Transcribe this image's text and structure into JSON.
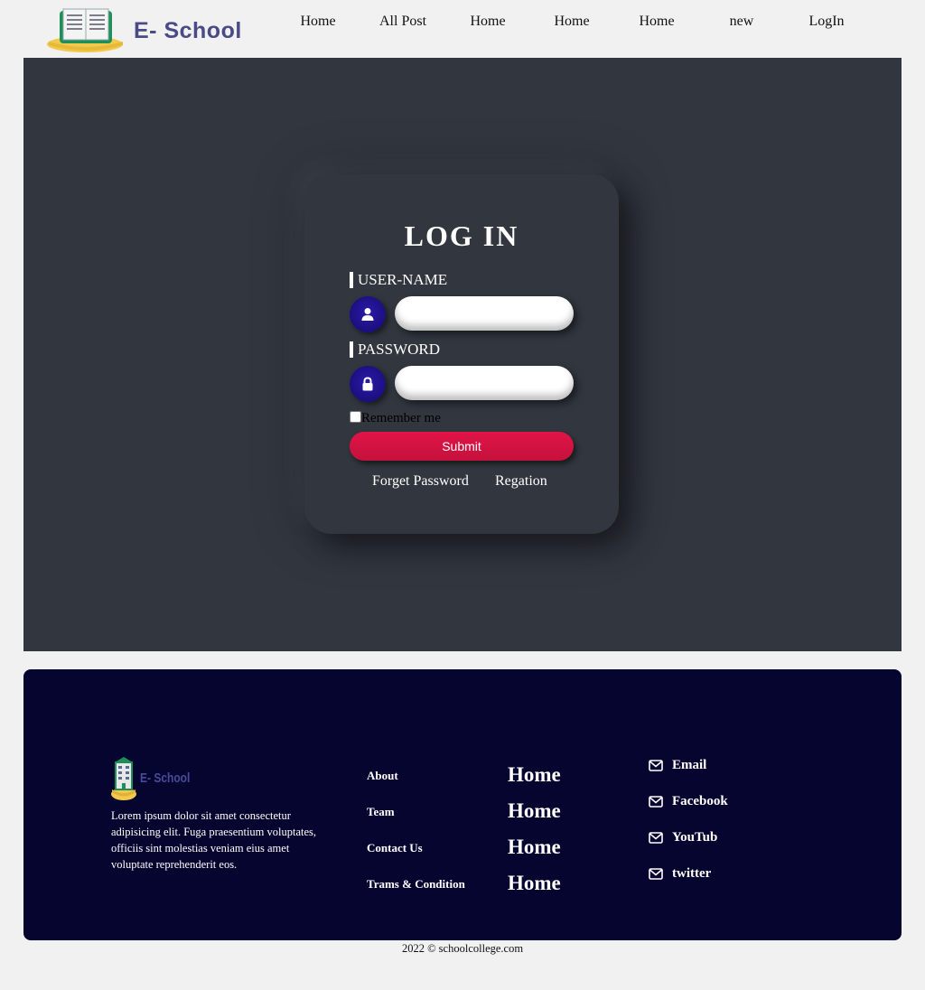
{
  "nav": {
    "logo_text": "E- School",
    "links": [
      "Home",
      "All Post",
      "Home",
      "Home",
      "Home",
      "new",
      "LogIn"
    ]
  },
  "login": {
    "title": "LOG IN",
    "username_label": "USER-NAME",
    "password_label": "PASSWORD",
    "username_value": "",
    "password_value": "",
    "remember_label": "Remember me",
    "remember_checked": false,
    "submit_label": "Submit",
    "forget_label": "Forget Password",
    "register_label": "Regation"
  },
  "footer": {
    "logo_text": "E- School",
    "description": "Lorem ipsum dolor sit amet consectetur adipisicing elit. Fuga praesentium voluptates, officiis sint molestias veniam eius amet voluptate reprehenderit eos.",
    "links": [
      "About",
      "Team",
      "Contact Us",
      "Trams & Condition"
    ],
    "home_links": [
      "Home",
      "Home",
      "Home",
      "Home"
    ],
    "contacts": [
      "Email",
      "Facebook",
      "YouTub",
      "twitter"
    ]
  },
  "copyright": "2022 © schoolcollege.com",
  "colors": {
    "hero_bg": "#31363f",
    "footer_bg": "#06052f",
    "accent_red": "#d5133f",
    "icon_blue": "#1e0f8c",
    "logo_text": "#4a4a85"
  },
  "icons": {
    "username": "user-icon",
    "password": "lock-icon",
    "contact": "envelope-icon"
  }
}
